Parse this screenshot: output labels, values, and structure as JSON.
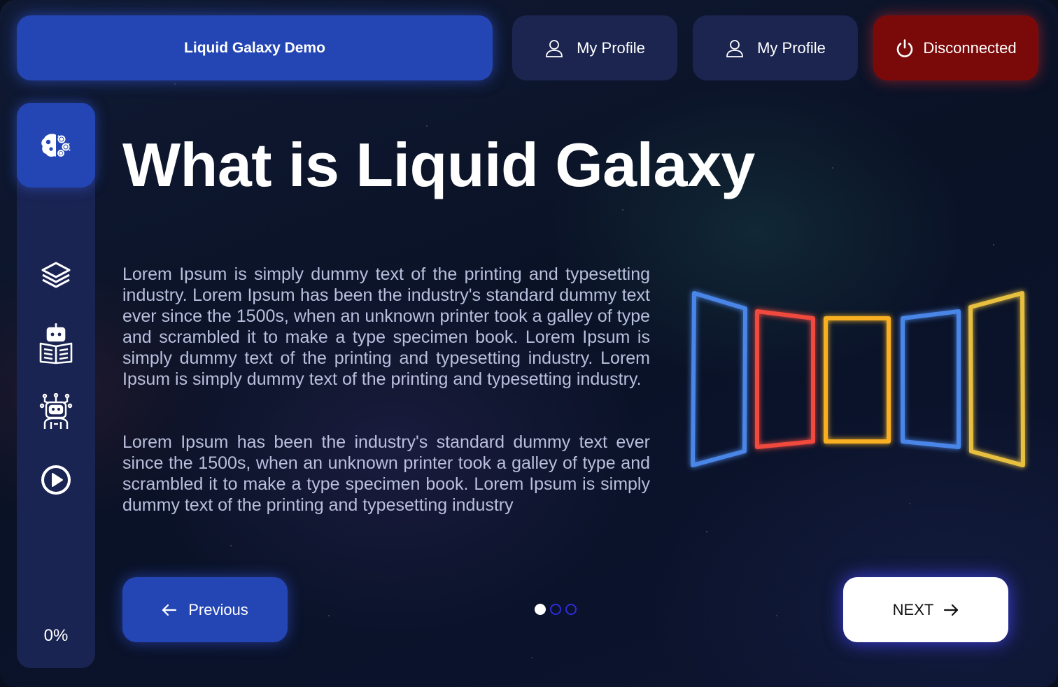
{
  "header": {
    "app_title": "Liquid Galaxy Demo",
    "profile_buttons": [
      {
        "label": "My Profile",
        "icon": "user-icon"
      },
      {
        "label": "My Profile",
        "icon": "user-icon"
      }
    ],
    "connection": {
      "label": "Disconnected",
      "icon": "power-icon",
      "status_color": "#7a0a0a"
    }
  },
  "sidebar": {
    "items": [
      {
        "icon": "brain-gears-icon",
        "active": true
      },
      {
        "icon": "layers-icon",
        "active": false
      },
      {
        "icon": "robot-reading-icon",
        "active": false
      },
      {
        "icon": "robot-head-icon",
        "active": false
      },
      {
        "icon": "play-circle-icon",
        "active": false
      }
    ],
    "progress": "0%"
  },
  "main": {
    "title": "What is Liquid Galaxy",
    "paragraphs": [
      "Lorem Ipsum is simply dummy text of the printing and typesetting industry. Lorem Ipsum has been the industry's standard dummy text ever since the 1500s, when an unknown printer took a galley of type and scrambled it to make a type specimen book. Lorem Ipsum is simply dummy text of the printing and typesetting industry. Lorem Ipsum is simply dummy text of the printing and typesetting industry.",
      "Lorem Ipsum has been the industry's standard dummy text ever since the 1500s, when an unknown printer took a galley of type and scrambled it to make a type specimen book. Lorem Ipsum is simply dummy text of the printing and typesetting industry"
    ],
    "illustration": {
      "panel_colors": [
        "#4a86e8",
        "#f04a3c",
        "#f8b020",
        "#4a86e8",
        "#e8c040"
      ]
    }
  },
  "navigation": {
    "previous_label": "Previous",
    "next_label": "NEXT",
    "pagination": {
      "total": 3,
      "current": 1
    }
  },
  "colors": {
    "accent": "#2446b4",
    "surface": "#1a2452",
    "danger": "#7a0a0a"
  }
}
